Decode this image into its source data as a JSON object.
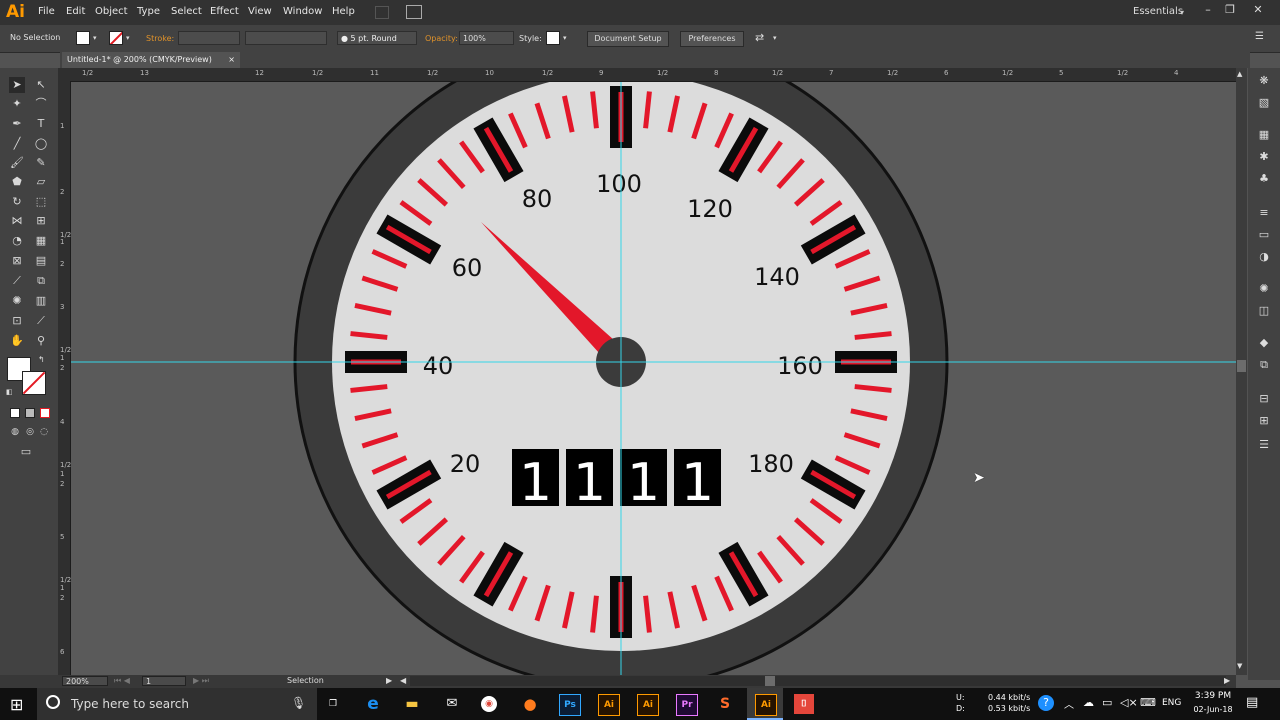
{
  "app": {
    "logo": "Ai",
    "menu": [
      "File",
      "Edit",
      "Object",
      "Type",
      "Select",
      "Effect",
      "View",
      "Window",
      "Help"
    ],
    "workspace": "Essentials",
    "window_controls": [
      "minimize-icon",
      "restore-icon",
      "close-icon"
    ]
  },
  "control_bar": {
    "selection": "No Selection",
    "stroke_label": "Stroke:",
    "brush": "5 pt. Round",
    "opacity_label": "Opacity:",
    "opacity_value": "100%",
    "style_label": "Style:",
    "document_setup": "Document Setup",
    "preferences": "Preferences"
  },
  "document": {
    "tab_title": "Untitled-1* @ 200% (CMYK/Preview)",
    "ruler_h": [
      "1/2",
      "13",
      "12",
      "1/2",
      "11",
      "1/2",
      "10",
      "1/2",
      "9",
      "1/2",
      "8",
      "1/2",
      "7",
      "1/2",
      "6",
      "1/2",
      "5",
      "1/2",
      "4"
    ],
    "ruler_v": [
      "1",
      "2",
      "1/2",
      "1",
      "2",
      "3",
      "1/2",
      "1",
      "2",
      "4",
      "1/2",
      "1",
      "2",
      "5",
      "1/2",
      "1",
      "2",
      "6"
    ]
  },
  "gauge": {
    "labels": [
      "20",
      "40",
      "60",
      "80",
      "100",
      "120",
      "140",
      "160",
      "180"
    ],
    "odometer": [
      "1",
      "1",
      "1",
      "1"
    ],
    "colors": {
      "bezel": "#3b3b3b",
      "face": "#dcdcdc",
      "tick": "#e3172a",
      "major": "#0b0b0b",
      "needle": "#e3172a",
      "hub": "#3b3b3b",
      "guide": "#34d6e8"
    }
  },
  "status": {
    "zoom": "200%",
    "artboard": "1",
    "tool": "Selection"
  },
  "taskbar": {
    "search_placeholder": "Type here to search",
    "net_up": "0.44 kbit/s",
    "net_down": "0.53 kbit/s",
    "net_u": "U:",
    "net_d": "D:",
    "lang": "ENG",
    "time": "3:39 PM",
    "date": "02-Jun-18"
  }
}
